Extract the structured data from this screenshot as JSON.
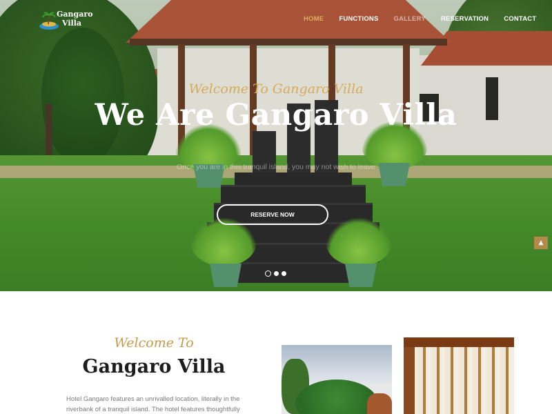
{
  "brand": {
    "line1": "Gangaro",
    "line2": "Villa"
  },
  "nav": {
    "items": [
      {
        "label": "HOME",
        "state": "active"
      },
      {
        "label": "FUNCTIONS",
        "state": "normal"
      },
      {
        "label": "GALLERY",
        "state": "faded"
      },
      {
        "label": "RESERVATION",
        "state": "normal"
      },
      {
        "label": "CONTACT",
        "state": "normal"
      }
    ]
  },
  "hero": {
    "kicker": "Welcome To Gangaro Villa",
    "title": "We Are Gangaro Villa",
    "subtitle": "Once you are in this tranquil island, you may not wish to leave",
    "cta": "RESERVE NOW",
    "slides": {
      "count": 3,
      "active_index": 0
    }
  },
  "welcome": {
    "script": "Welcome To",
    "title": "Gangaro Villa",
    "body": "Hotel Gangaro features an unrivalled location, literally in the riverbank of a tranquil island. The hotel features thoughtfully"
  },
  "colors": {
    "accent_gold": "#d6ab57",
    "scroll_top": "#b48a4a",
    "heading_dark": "#1d1d1d",
    "body_gray": "#7a7a7a"
  },
  "icons": {
    "scroll_top": "chevron-up-icon",
    "logo": "island-logo-icon"
  }
}
